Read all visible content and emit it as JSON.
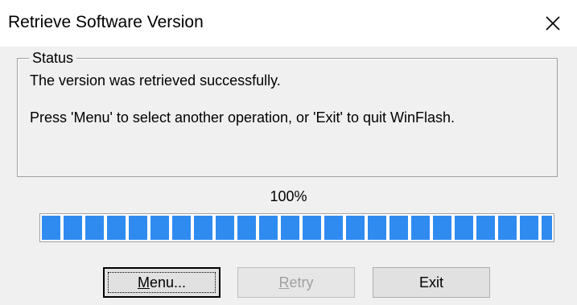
{
  "window": {
    "title": "Retrieve Software Version",
    "close_icon": "close-icon"
  },
  "status_group": {
    "legend": "Status",
    "line1": "The version was retrieved successfully.",
    "line2": "Press 'Menu' to select another operation, or 'Exit' to quit WinFlash."
  },
  "progress": {
    "percent_label": "100%",
    "value_fraction": 1.0,
    "fill_color": "#2f8bf0"
  },
  "buttons": {
    "menu": {
      "mnemonic": "M",
      "rest": "enu...",
      "enabled": true,
      "default": true
    },
    "retry": {
      "mnemonic": "R",
      "rest": "etry",
      "enabled": false
    },
    "exit": {
      "label": "Exit",
      "enabled": true
    }
  }
}
